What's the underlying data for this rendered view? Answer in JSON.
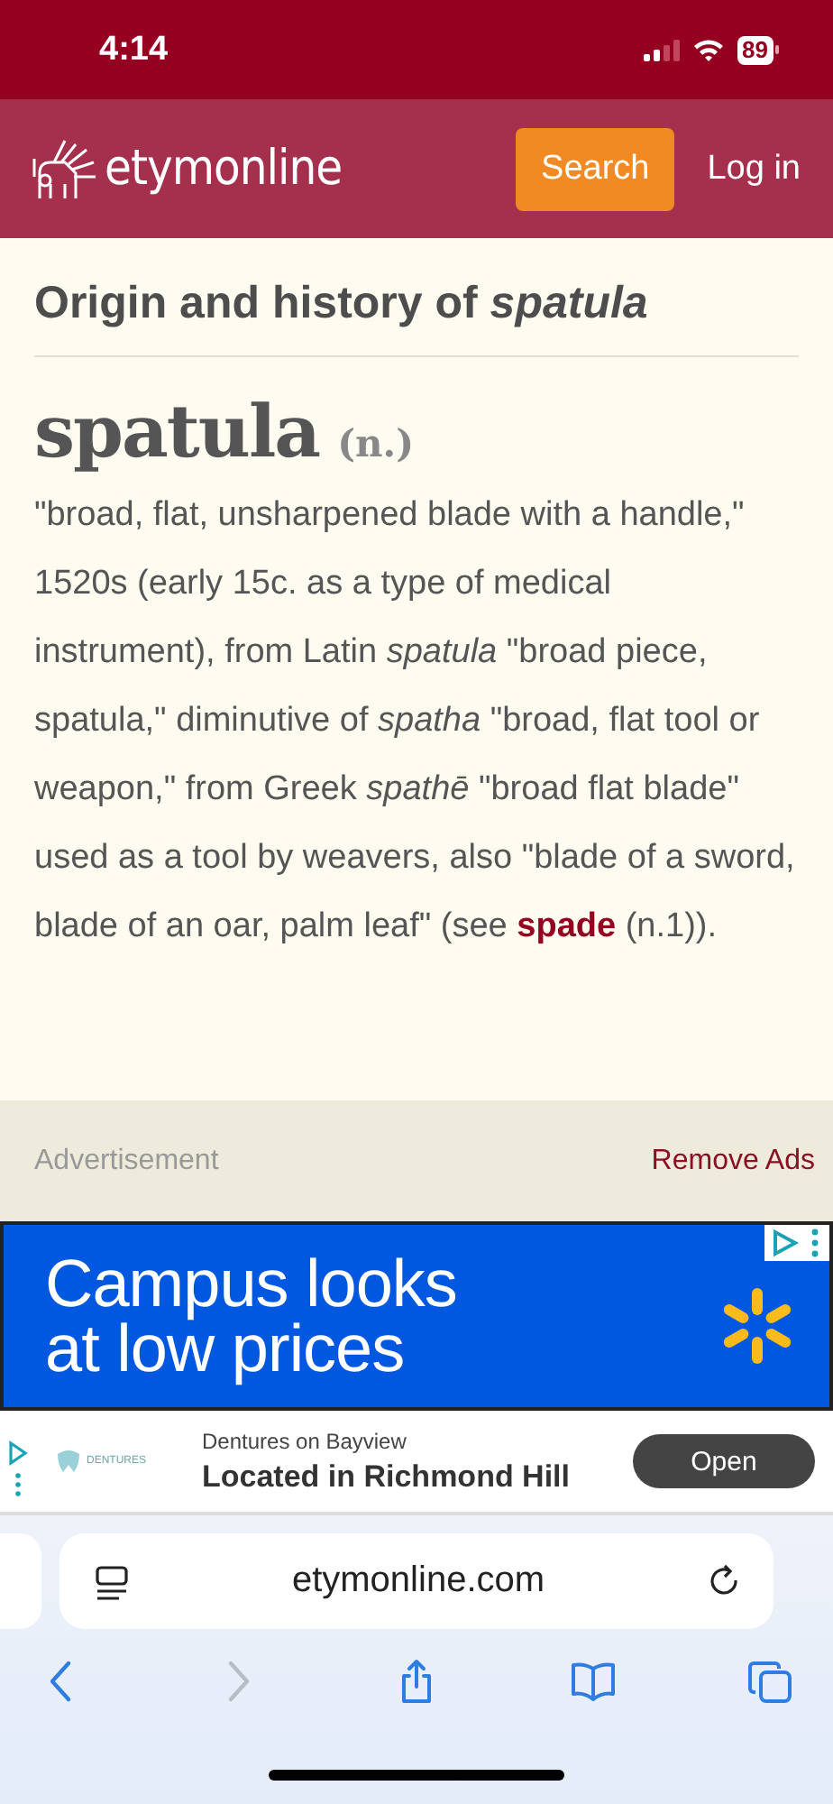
{
  "status_bar": {
    "time": "4:14",
    "battery": "89"
  },
  "header": {
    "logo": "etymonline",
    "search_button": "Search",
    "login_link": "Log in"
  },
  "article": {
    "heading": "Origin and history of *spatula*",
    "word": "spatula",
    "part_of_speech": "(n.)",
    "definition_before": "\"broad, flat, unsharpened blade with a handle,\" 1520s (early 15c. as a type of medical instrument), from Latin *spatula* \"broad piece, spatula,\" diminutive of *spatha* \"broad, flat tool or weapon,\" from Greek *spathē* \"broad flat blade\" used as a tool by weavers, also \"blade of a sword, blade of an oar, palm leaf\" (see ",
    "link": "spade",
    "definition_after": " (n.1))."
  },
  "ad_bar": {
    "label": "Advertisement",
    "remove_link": "Remove Ads"
  },
  "banner_ad": {
    "headline_1": "Campus looks",
    "headline_2": "at low prices"
  },
  "bottom_ad": {
    "logo_text": "DENTURES",
    "advertiser": "Dentures on Bayview",
    "headline": "Located in Richmond Hill",
    "button": "Open"
  },
  "browser": {
    "url": "etymonline.com",
    "toolbar": [
      {
        "kind": "back",
        "disabled": false
      },
      {
        "kind": "forward",
        "disabled": true
      },
      {
        "kind": "share",
        "disabled": false
      },
      {
        "kind": "bookmarks",
        "disabled": false
      },
      {
        "kind": "tabs",
        "disabled": false
      }
    ]
  }
}
